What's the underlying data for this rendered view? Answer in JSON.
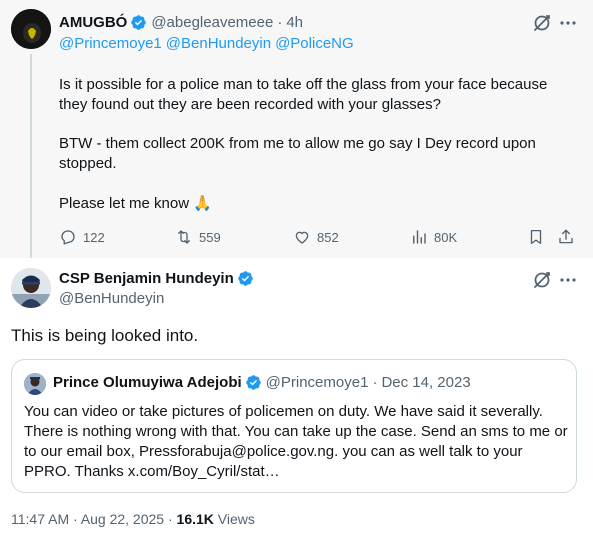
{
  "parent_tweet": {
    "author_name": "AMUGBÓ",
    "author_handle": "@abegleavemeee",
    "separator": "·",
    "time_ago": "4h",
    "mentions": [
      "@Princemoye1",
      "@BenHundeyin",
      "@PoliceNG"
    ],
    "paragraph_1": "Is it possible for a police man to take off the glass from your face because they found out they are been recorded with your glasses?",
    "paragraph_2": "BTW - them collect 200K from me to allow me go say I Dey record upon stopped.",
    "paragraph_3": "Please let me know",
    "paragraph_3_emoji": "🙏",
    "stats": {
      "replies": "122",
      "retweets": "559",
      "likes": "852",
      "views": "80K"
    }
  },
  "main_tweet": {
    "author_name": "CSP Benjamin Hundeyin",
    "author_handle": "@BenHundeyin",
    "text": "This is being looked into.",
    "timestamp": "11:47 AM · Aug 22, 2025",
    "separator": "·",
    "views_count": "16.1K",
    "views_label": "Views"
  },
  "quoted_tweet": {
    "author_name": "Prince Olumuyiwa Adejobi",
    "author_handle": "@Princemoye1",
    "separator": "·",
    "date": "Dec 14, 2023",
    "text": "You can video or take pictures of policemen on duty. We have said it severally. There is nothing wrong with that. You can take up the case. Send an sms to me or to our email box, Pressforabuja@police.gov.ng. you can as well talk to your PPRO.  Thanks x.com/Boy_Cyril/stat…"
  },
  "icons": {
    "verified": "verified-badge-icon",
    "grok": "grok-icon",
    "more": "more-icon",
    "reply": "reply-icon",
    "retweet": "retweet-icon",
    "like": "like-icon",
    "views": "views-icon",
    "bookmark": "bookmark-icon",
    "share": "share-icon"
  },
  "colors": {
    "accent": "#1d9bf0",
    "text_primary": "#0f1419",
    "text_secondary": "#536471",
    "parent_background": "#f7f7f7"
  }
}
